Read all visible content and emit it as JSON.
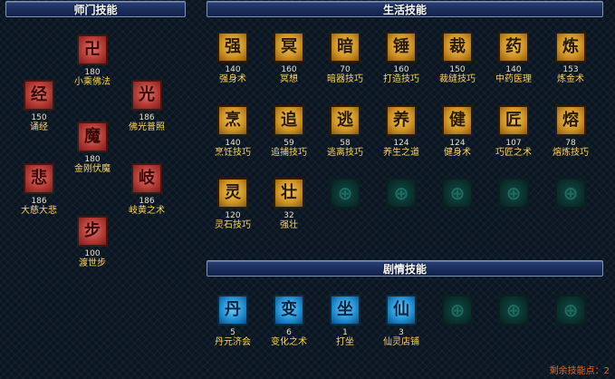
{
  "sections": {
    "master": "师门技能",
    "life": "生活技能",
    "story": "剧情技能"
  },
  "master_skills": [
    {
      "name": "小乘佛法",
      "level": "180",
      "glyph": "卍"
    },
    {
      "name": "诵经",
      "level": "150",
      "glyph": "经"
    },
    {
      "name": "佛光普照",
      "level": "186",
      "glyph": "光"
    },
    {
      "name": "金刚伏魔",
      "level": "180",
      "glyph": "魔"
    },
    {
      "name": "大慈大悲",
      "level": "186",
      "glyph": "悲"
    },
    {
      "name": "岐黄之术",
      "level": "186",
      "glyph": "岐"
    },
    {
      "name": "渡世步",
      "level": "100",
      "glyph": "步"
    }
  ],
  "life_skills": [
    {
      "name": "强身术",
      "level": "140",
      "glyph": "强"
    },
    {
      "name": "冥想",
      "level": "160",
      "glyph": "冥"
    },
    {
      "name": "暗器技巧",
      "level": "70",
      "glyph": "暗"
    },
    {
      "name": "打造技巧",
      "level": "160",
      "glyph": "锤"
    },
    {
      "name": "裁缝技巧",
      "level": "150",
      "glyph": "裁"
    },
    {
      "name": "中药医理",
      "level": "140",
      "glyph": "药"
    },
    {
      "name": "炼金术",
      "level": "153",
      "glyph": "炼"
    },
    {
      "name": "烹饪技巧",
      "level": "140",
      "glyph": "烹"
    },
    {
      "name": "追捕技巧",
      "level": "59",
      "glyph": "追"
    },
    {
      "name": "逃离技巧",
      "level": "58",
      "glyph": "逃"
    },
    {
      "name": "养生之道",
      "level": "124",
      "glyph": "养"
    },
    {
      "name": "健身术",
      "level": "124",
      "glyph": "健"
    },
    {
      "name": "巧匠之术",
      "level": "107",
      "glyph": "匠"
    },
    {
      "name": "熔炼技巧",
      "level": "78",
      "glyph": "熔"
    },
    {
      "name": "灵石技巧",
      "level": "120",
      "glyph": "灵"
    },
    {
      "name": "强壮",
      "level": "32",
      "glyph": "壮"
    }
  ],
  "story_skills": [
    {
      "name": "丹元济会",
      "level": "5",
      "glyph": "丹"
    },
    {
      "name": "变化之术",
      "level": "6",
      "glyph": "变"
    },
    {
      "name": "打坐",
      "level": "1",
      "glyph": "坐"
    },
    {
      "name": "仙灵店铺",
      "level": "3",
      "glyph": "仙"
    }
  ],
  "empty_slot_glyph": "⊕",
  "footer": {
    "remaining_points": "剩余技能点：2"
  },
  "colors": {
    "master_icon": "#b43b36",
    "life_icon": "#cf9426",
    "story_icon": "#2290d2",
    "empty_icon": "#0f4a44",
    "skill_name": "#ffd45a",
    "remaining_text": "#e06a2c"
  }
}
